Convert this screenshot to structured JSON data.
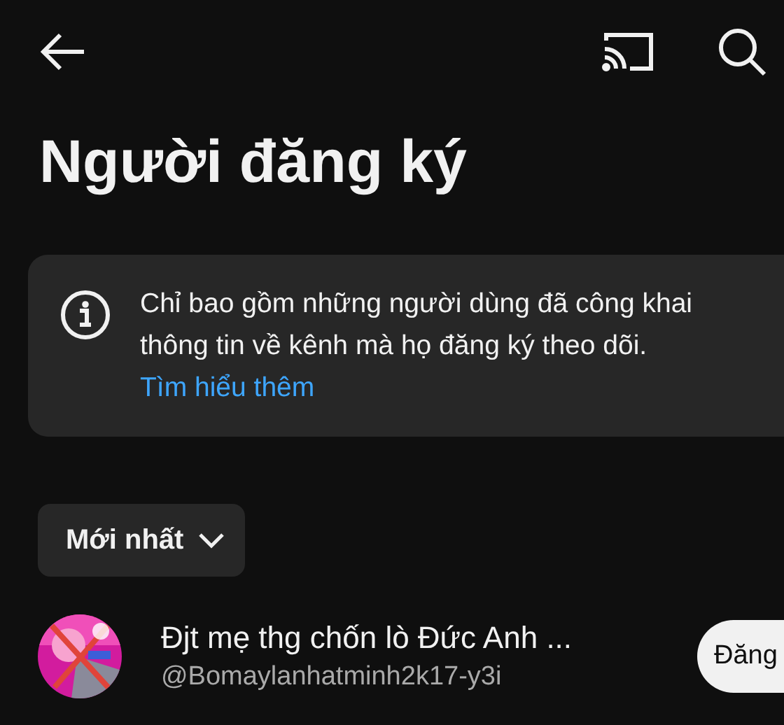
{
  "header": {
    "title": "Người đăng ký"
  },
  "notice": {
    "text": "Chỉ bao gồm những người dùng đã công khai thông tin về kênh mà họ đăng ký theo dõi.",
    "link": "Tìm hiểu thêm"
  },
  "sort": {
    "label": "Mới nhất"
  },
  "subscribers": [
    {
      "name": "Đjt mẹ thg chốn lò Đức Anh ...",
      "handle": "@Bomaylanhatminh2k17-y3i",
      "button": "Đăng",
      "kind": "picture"
    }
  ]
}
